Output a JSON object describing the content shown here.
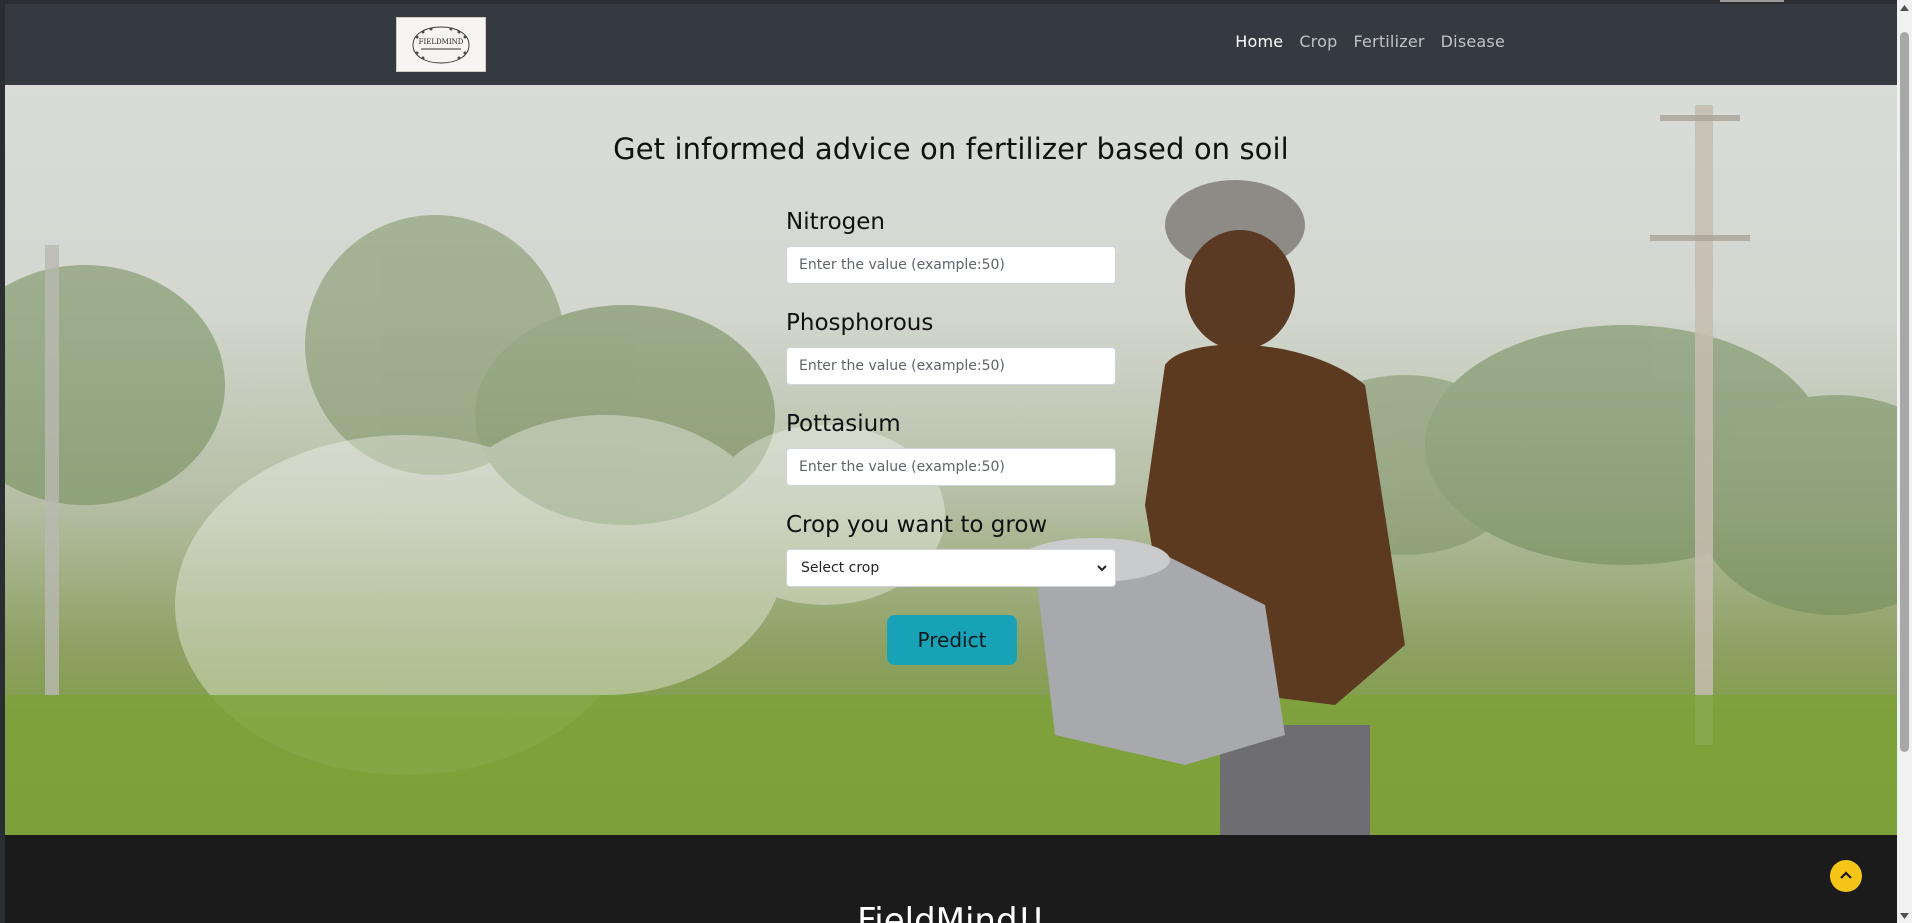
{
  "navbar": {
    "logo_text": "FIELDMIND",
    "links": [
      {
        "label": "Home",
        "active": true
      },
      {
        "label": "Crop",
        "active": false
      },
      {
        "label": "Fertilizer",
        "active": false
      },
      {
        "label": "Disease",
        "active": false
      }
    ]
  },
  "hero": {
    "title": "Get informed advice on fertilizer based on soil",
    "fields": [
      {
        "label": "Nitrogen",
        "placeholder": "Enter the value (example:50)",
        "value": ""
      },
      {
        "label": "Phosphorous",
        "placeholder": "Enter the value (example:50)",
        "value": ""
      },
      {
        "label": "Pottasium",
        "placeholder": "Enter the value (example:50)",
        "value": ""
      }
    ],
    "crop_select": {
      "label": "Crop you want to grow",
      "selected": "Select crop"
    },
    "predict_label": "Predict"
  },
  "footer": {
    "title": "FieldMind!!"
  },
  "colors": {
    "navbar": "#343a40",
    "predict_button": "#17a2b8",
    "back_to_top": "#f5c518",
    "footer": "#1b1b1b"
  },
  "icons": {
    "back_to_top": "chevron-up-icon",
    "select_arrow": "chevron-down-icon"
  }
}
